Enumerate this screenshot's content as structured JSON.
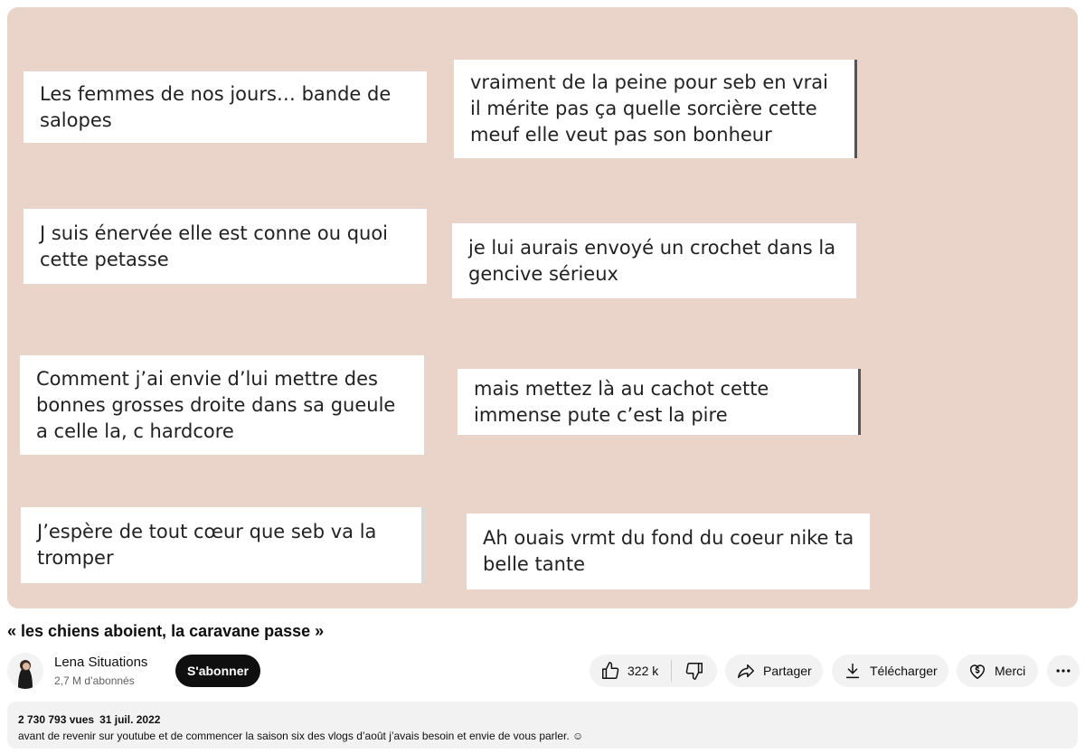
{
  "video": {
    "comments": [
      "Les femmes de nos jours… bande de salopes",
      "vraiment de la peine pour seb en vrai il mérite pas ça quelle sorcière cette meuf elle veut pas son bonheur",
      "J suis énervée elle est conne ou quoi cette petasse",
      "je lui aurais envoyé un crochet dans la gencive sérieux",
      "Comment j’ai envie d’lui mettre des bonnes grosses droite dans sa gueule a celle la, c hardcore",
      "mais mettez là au cachot cette immense pute c’est la pire",
      "J’espère de tout cœur que seb va la tromper",
      "Ah ouais vrmt du fond du coeur nike ta belle tante"
    ],
    "background_color": "#ead4ca"
  },
  "title": "« les chiens aboient, la caravane passe »",
  "channel": {
    "name": "Lena Situations",
    "subscribers": "2,7 M d’abonnés",
    "subscribe_label": "S'abonner"
  },
  "actions": {
    "like_count": "322 k",
    "share_label": "Partager",
    "download_label": "Télécharger",
    "thanks_label": "Merci",
    "icons": [
      "like-icon",
      "dislike-icon",
      "share-icon",
      "download-icon",
      "thanks-icon",
      "more-icon"
    ]
  },
  "description": {
    "views": "2 730 793 vues",
    "date": "31 juil. 2022",
    "text": "avant de revenir sur youtube et de commencer la saison six des vlogs d’août j’avais besoin et envie de vous parler. ☺"
  }
}
